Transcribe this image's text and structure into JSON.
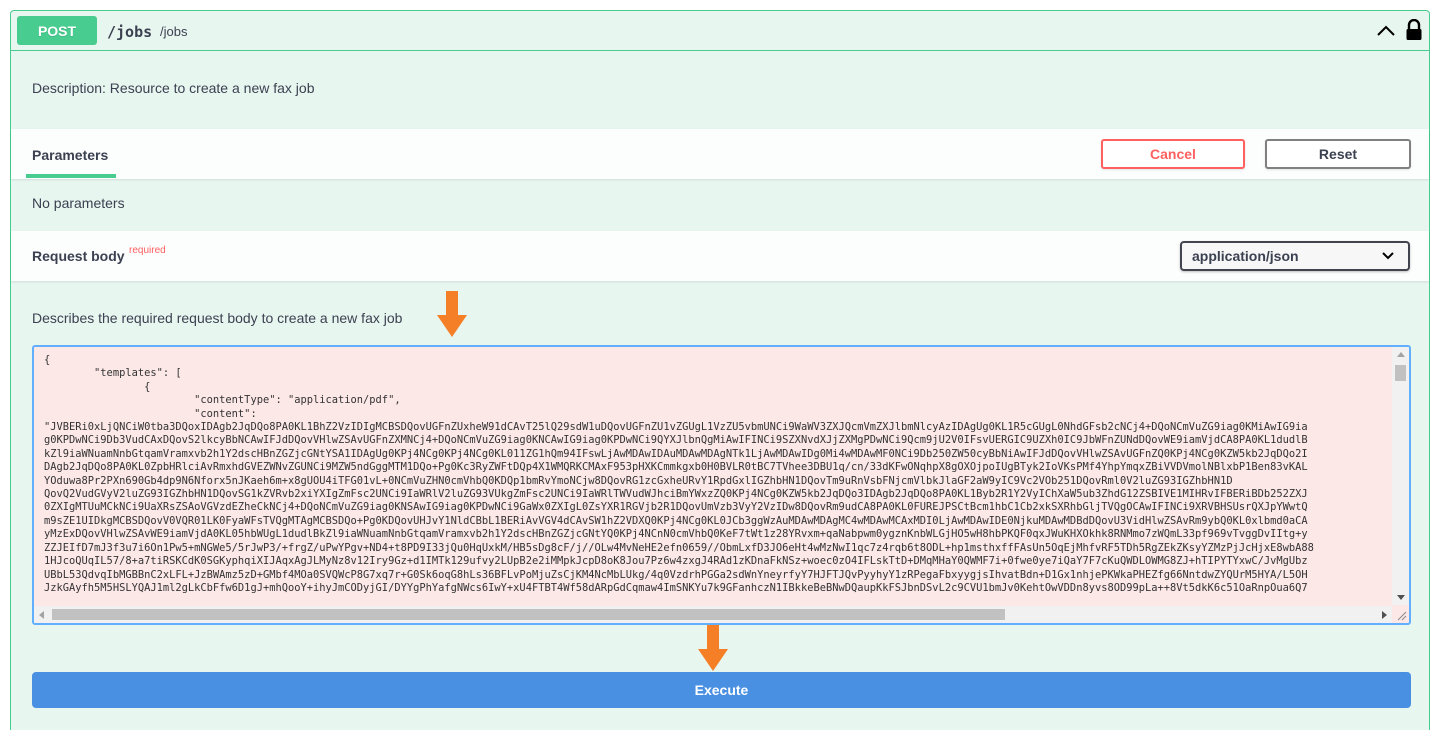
{
  "operation": {
    "method": "POST",
    "path": "/jobs",
    "path_description": "/jobs",
    "description": "Description: Resource to create a new fax job"
  },
  "parameters": {
    "tab_label": "Parameters",
    "cancel_label": "Cancel",
    "reset_label": "Reset",
    "empty_text": "No parameters"
  },
  "request_body": {
    "title": "Request body",
    "required_label": "required",
    "content_type": "application/json",
    "description": "Describes the required request body to create a new fax job",
    "code": "{\n        \"templates\": [\n                {\n                        \"contentType\": \"application/pdf\",\n                        \"content\":\n\"JVBERi0xLjQNCiW0tba3DQoxIDAgb2JqDQo8PA0KL1BhZ2VzIDIgMCBSDQovUGFnZUxheW91dCAvT25lQ29sdW1uDQovUGFnZU1vZGUgL1VzZU5vbmUNCi9WaWV3ZXJQcmVmZXJlbmNlcyAzIDAgUg0KL1R5cGUgL0NhdGFsb2cNCj4+DQoNCmVuZG9iag0KMiAwIG9ia\ng0KPDwNCi9Db3VudCAxDQovS2lkcyBbNCAwIFJdDQovVHlwZSAvUGFnZXMNCj4+DQoNCmVuZG9iag0KNCAwIG9iag0KPDwNCi9QYXJlbnQgMiAwIFINCi9SZXNvdXJjZXMgPDwNCi9Qcm9jU2V0IFsvUERGIC9UZXh0IC9JbWFnZUNdDQovWE9iamVjdCA8PA0KL1dudlB\nkZl9iaWNuamNnbGtqamVramxvb2h1Y2dscHBnZGZjcGNtYSA1IDAgUg0KPj4NCg0KPj4NCg0KL011ZG1hQm94IFswLjAwMDAwIDAuMDAwMDAgNTk1LjAwMDAwIDg0Mi4wMDAwMF0NCi9Db250ZW50cyBbNiAwIFJdDQovVHlwZSAvUGFnZQ0KPj4NCg0KZW5kb2JqDQo2I\nDAgb2JqDQo8PA0KL0ZpbHRlciAvRmxhdGVEZWNvZGUNCi9MZW5ndGggMTM1DQo+Pg0Kc3RyZWFtDQp4X1WMQRKCMAxF953pHXKCmmkgxb0H0BVLR0tBC7TVhee3DBU1q/cn/33dKFwONqhpX8gOXOjpoIUgBTyk2IoVKsPMf4YhpYmqxZBiVVDVmolNBlxbP1Ben83vKAL\nYOduwa8Pr2PXn690Gb4dp9N6Nforx5nJKaeh6m+x8gUOU4iTFG01vL+0NCmVuZHN0cmVhbQ0KDQp1bmRvYmoNCjw8DQovRG1zcGxheURvY1RpdGxlIGZhbHN1DQovTm9uRnVsbFNjcmVlbkJlaGF2aW9yIC9Vc2VOb251DQovRml0V2luZG93IGZhbHN1D\nQovQ2VudGVyV2luZG93IGZhbHN1DQovSG1kZVRvb2xiYXIgZmFsc2UNCi9IaWRlV2luZG93VUkgZmFsc2UNCi9IaWRlTWVudWJhciBmYWxzZQ0KPj4NCg0KZW5kb2JqDQo3IDAgb2JqDQo8PA0KL1Byb2R1Y2VyIChXaW5ub3ZhdG12ZSBIVE1MIHRvIFBERiBDb252ZXJ\n0ZXIgMTUuMCkNCi9UaXRsZSAoVGVzdEZheCkNCj4+DQoNCmVuZG9iag0KNSAwIG9iag0KPDwNCi9GaWx0ZXIgL0ZsYXR1RGVjb2R1DQovUmVzb3VyY2VzIDw8DQovRm9udCA8PA0KL0FUREJPSCtBcm1hbC1Cb2xkSXRhbGljTVQgOCAwIFINCi9XRVBHSUsrQXJpYWwtQ\nm9sZE1UIDkgMCBSDQovV0VQR01LK0FyaWFsTVQgMTAgMCBSDQo+Pg0KDQovUHJvY1NldCBbL1BERiAvVGV4dCAvSW1hZ2VDXQ0KPj4NCg0KL0JCb3ggWzAuMDAwMDAgMC4wMDAwMCAxMDI0LjAwMDAwIDE0NjkuMDAwMDBdDQovU3VidHlwZSAvRm9ybQ0KL0xlbmd0aCA\nyMzExDQovVHlwZSAvWE9iamVjdA0KL05hbWUgL1dudlBkZl9iaWNuamNnbGtqamVramxvb2h1Y2dscHBnZGZjcGNtYQ0KPj4NCnN0cmVhbQ0KeF7tWt1z28YRvxm+qaNabpwm0ygznKnbWLGjHO5wH8hbPKQF0qxJWuKHXOkhk8RNMmo7zWQmL33pf969vTvggDvIItg+y\nZZJEIfD7mJ3f3u7i6On1Pw5+mNGWe5/5rJwP3/+frgZ/uPwYPgv+ND4+t8PD9I33jQu0HqUxkM/HB5sDg8cF/j//OLw4MvNeHE2efn0659//ObmLxfD3JO6eHt4wMzNwI1qc7z4rqb6t8ODL+hp1msthxffFAsUn5OqEjMhfvRF5TDh5RgZEkZKsyYZMzPjJcHjxE8wbA88\n1HJcoQUqIL57/8+a7tiRSKCdK0SGKyphqiXIJAqxAgJLMyNz8v12Iry9Gz+d1IMTk129ufvy2LUpB2e2iMMpkJcpD8oK8Jou7Pz6w4zxgJ4RAd1zKDnaFkNSz+woec0zO4IFLskTtD+DMqMHaY0QWMF7i+0fwe0ye7iQaY7F7cKuQWDLOWMG8ZJ+hTIPYTYxwC/JvMgUbz\nUBbL53QdvqIbMGBBnC2xLFL+JzBWAmz5zD+GMbf4MOa0SVQWcP8G7xq7r+G0Sk6oqG8hLs36BFLvPoMjuZsCjKM4NcMbLUkg/4q0VzdrhPGGa2sdWnYneyrfyY7HJFTJQvPyyhyY1zRPegaFbxyygjsIhvatBdn+D1Gx1nhjePKWkaPHEZfg66NntdwZYQUrM5HYA/L5OH\nJzkGAyfh5M5HSLYQAJ1ml2gLkCbFfw6D1gJ+mhQooY+ihyJmCODyjGI/DYYgPhYafgNWcs6IwY+xU4FTBT4Wf58dARpGdCqmaw4ImSNKYu7k9GFanhczN1IBkkeBeBNwDQaupKkFSJbnDSvL2c9CVU1bmJv0KehtOwVDDn8yvs8OD99pLa++8Vt5dkK6c51OaRnpOua6Q7"
  },
  "execute_label": "Execute",
  "colors": {
    "accent": "#49cc90",
    "block_background": "#e8f6f0",
    "cancel": "#ff6060",
    "execute": "#4990e2",
    "required": "#ff6060",
    "arrow": "#f47f27",
    "code_background": "#fde8e8"
  },
  "icons": {
    "collapse": "chevron-up-icon",
    "auth": "lock-icon",
    "select": "chevron-down-icon",
    "annotation": "down-arrow-icon"
  }
}
